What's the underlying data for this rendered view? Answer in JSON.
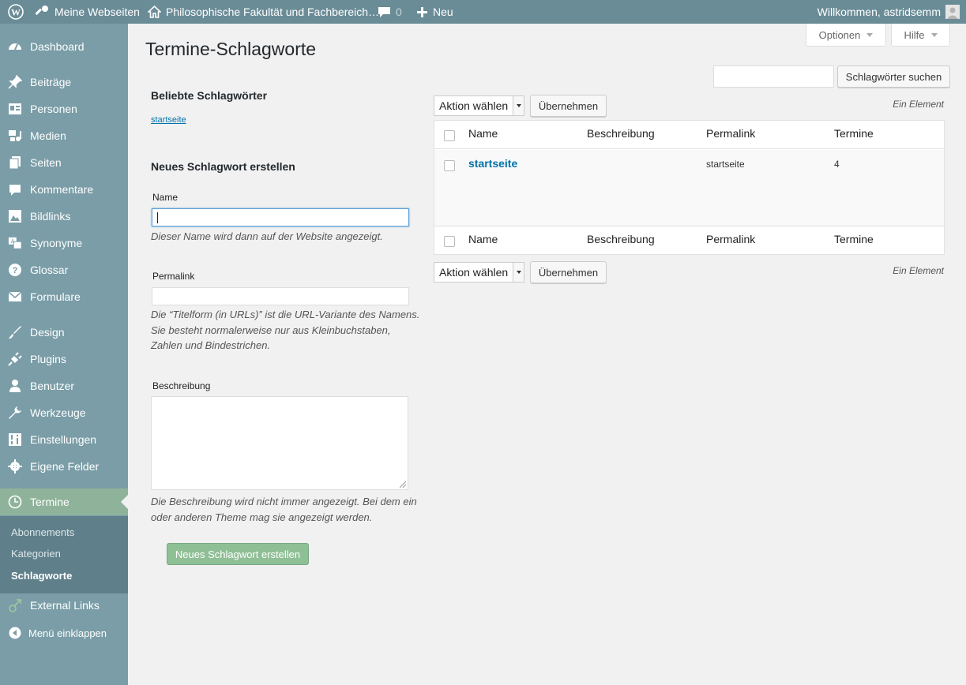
{
  "admin_bar": {
    "my_sites": "Meine Webseiten",
    "site_name": "Philosophische Fakultät und Fachbereich…",
    "comments_count": "0",
    "new_label": "Neu",
    "greeting": "Willkommen, astridsemm"
  },
  "sidebar": {
    "items": [
      {
        "label": "Dashboard",
        "icon": "dashboard-icon"
      },
      {
        "label": "Beiträge",
        "icon": "pin-icon"
      },
      {
        "label": "Personen",
        "icon": "id-card-icon"
      },
      {
        "label": "Medien",
        "icon": "media-icon"
      },
      {
        "label": "Seiten",
        "icon": "pages-icon"
      },
      {
        "label": "Kommentare",
        "icon": "comment-icon"
      },
      {
        "label": "Bildlinks",
        "icon": "image-icon"
      },
      {
        "label": "Synonyme",
        "icon": "translate-icon"
      },
      {
        "label": "Glossar",
        "icon": "help-icon"
      },
      {
        "label": "Formulare",
        "icon": "mail-icon"
      },
      {
        "label": "Design",
        "icon": "brush-icon"
      },
      {
        "label": "Plugins",
        "icon": "plugin-icon"
      },
      {
        "label": "Benutzer",
        "icon": "user-icon"
      },
      {
        "label": "Werkzeuge",
        "icon": "wrench-icon"
      },
      {
        "label": "Einstellungen",
        "icon": "settings-icon"
      },
      {
        "label": "Eigene Felder",
        "icon": "gear-icon"
      },
      {
        "label": "Termine",
        "icon": "clock-icon"
      },
      {
        "label": "External Links",
        "icon": "external-link-icon"
      },
      {
        "label": "Menü einklappen",
        "icon": "collapse-icon"
      }
    ],
    "submenu": [
      "Abonnements",
      "Kategorien",
      "Schlagworte"
    ]
  },
  "screen_options": "Optionen",
  "help": "Hilfe",
  "page_title": "Termine-Schlagworte",
  "search_button": "Schlagwörter suchen",
  "popular": {
    "heading": "Beliebte Schlagwörter",
    "tag": "startseite"
  },
  "form": {
    "heading": "Neues Schlagwort erstellen",
    "name_label": "Name",
    "name_desc": "Dieser Name wird dann auf der Website angezeigt.",
    "slug_label": "Permalink",
    "slug_desc_1": "Die “Titelform (in URLs)” ist die URL-Variante des Namens.",
    "slug_desc_2": "Sie besteht normalerweise nur aus Kleinbuchstaben,",
    "slug_desc_3": "Zahlen und Bindestrichen.",
    "description_label": "Beschreibung",
    "description_desc_1": "Die Beschreibung wird nicht immer angezeigt. Bei dem ein",
    "description_desc_2": "oder anderen Theme mag sie angezeigt werden.",
    "submit": "Neues Schlagwort erstellen"
  },
  "bulk": {
    "action": "Aktion wählen",
    "apply": "Übernehmen",
    "count": "Ein Element"
  },
  "table": {
    "columns": [
      "Name",
      "Beschreibung",
      "Permalink",
      "Termine"
    ],
    "rows": [
      {
        "name": "startseite",
        "description": "",
        "slug": "startseite",
        "count": "4"
      }
    ]
  },
  "colors": {
    "admin_bar": "#6a8c97",
    "sidebar": "#7a9da7",
    "active_menu": "#8fb39a",
    "link": "#0073aa"
  }
}
